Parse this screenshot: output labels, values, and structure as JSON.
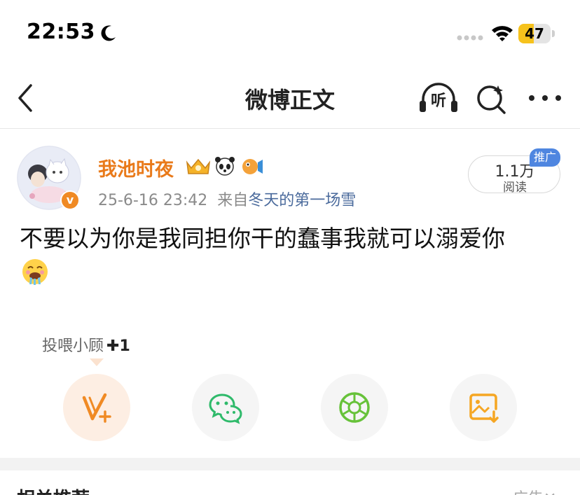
{
  "status_bar": {
    "time": "22:53",
    "battery_level": "47",
    "battery_fraction": 0.47,
    "icons": [
      "moon-icon",
      "signal-icon",
      "wifi-icon",
      "battery-icon"
    ]
  },
  "nav": {
    "title": "微博正文",
    "listen_label": "听",
    "icons": [
      "back-icon",
      "listen-icon",
      "search-icon",
      "more-icon"
    ]
  },
  "post": {
    "username": "我池时夜",
    "verified_symbol": "v",
    "timestamp": "25-6-16 23:42",
    "from_label": "来自",
    "source": "冬天的第一场雪",
    "read_count": "1.1万",
    "read_label": "阅读",
    "promo_label": "推广",
    "text": "不要以为你是我同担你干的蠢事我就可以溺爱你",
    "emoji": "drooling-face-icon"
  },
  "share": {
    "tooltip_label": "投喂小顾",
    "tooltip_plus": "✚1",
    "actions": [
      "weibo-feed-icon",
      "wechat-icon",
      "moments-icon",
      "save-image-icon"
    ]
  },
  "related": {
    "title": "相关推荐",
    "ad_label": "广告✕"
  },
  "colors": {
    "accent_orange": "#e97a1a",
    "link_blue": "#4a6a9c",
    "wechat_green": "#2fba6b",
    "promo_blue": "#4f86e0",
    "battery_yellow": "#f6c21c"
  }
}
